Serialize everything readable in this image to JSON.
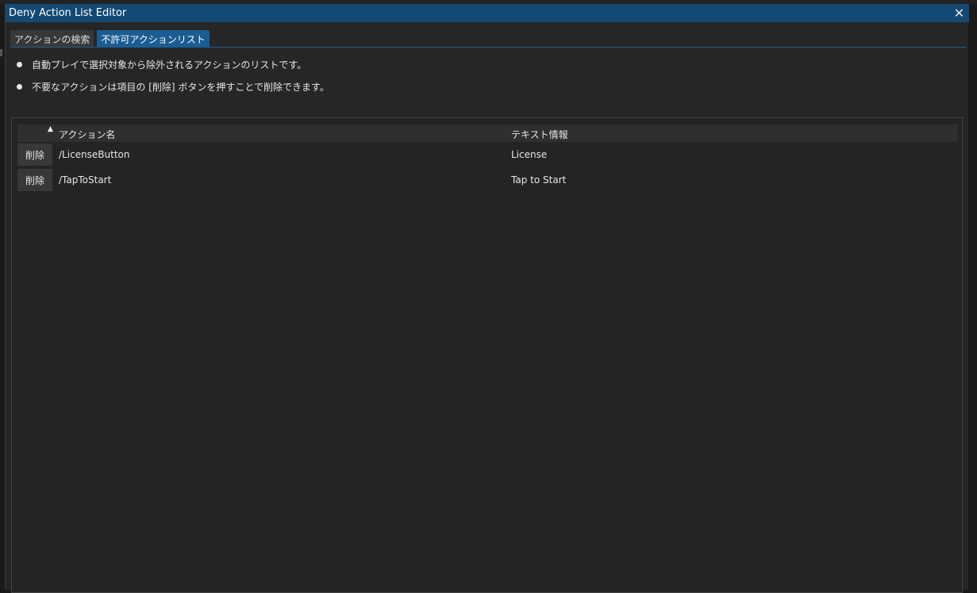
{
  "window": {
    "title": "Deny Action List Editor",
    "close_glyph": "✕"
  },
  "tabs": [
    {
      "label": "アクションの検索",
      "active": false
    },
    {
      "label": "不許可アクションリスト",
      "active": true
    }
  ],
  "info": {
    "bullets": [
      "自動プレイで選択対象から除外されるアクションのリストです。",
      "不要なアクションは項目の [削除] ボタンを押すことで削除できます。"
    ]
  },
  "table": {
    "sort_indicator": "▲",
    "columns": {
      "name": "アクション名",
      "text": "テキスト情報"
    },
    "rows": [
      {
        "delete_label": "削除",
        "name": "/LicenseButton",
        "text": "License"
      },
      {
        "delete_label": "削除",
        "name": "/TapToStart",
        "text": "Tap to Start"
      }
    ]
  },
  "colors": {
    "titlebar": "#134a75",
    "active_tab": "#1a5d93",
    "background": "#262626"
  },
  "icons": {
    "close": "close-icon",
    "sort": "sort-ascending-icon",
    "bullet": "bullet-dot-icon"
  }
}
